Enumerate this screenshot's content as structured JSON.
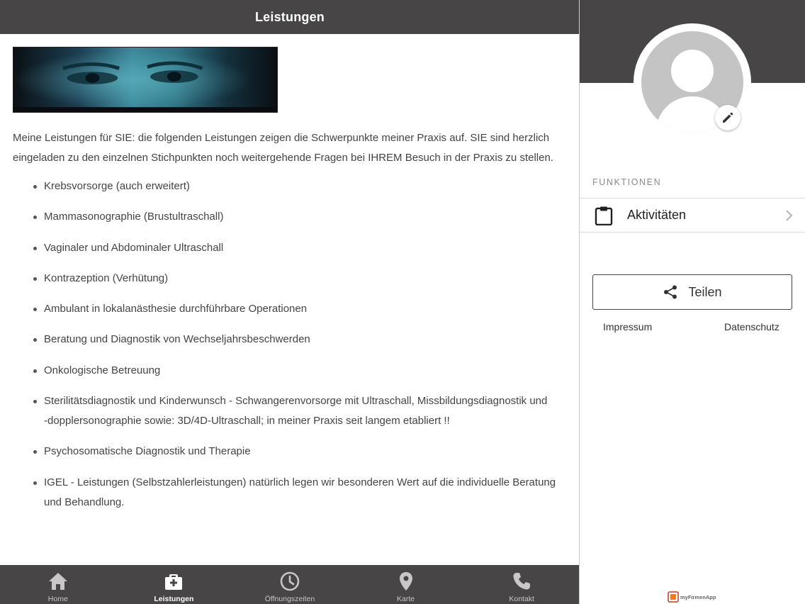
{
  "main": {
    "title": "Leistungen",
    "banner_alt": "",
    "intro": "Meine Leistungen für SIE: die folgenden Leistungen zeigen die Schwerpunkte meiner Praxis auf. SIE sind herzlich eingeladen zu den einzelnen Stichpunkten noch weitergehende Fragen bei IHREM Besuch in der Praxis zu stellen.",
    "services": [
      "Krebsvorsorge (auch erweitert)",
      "Mammasonographie (Brustultraschall)",
      "Vaginaler und Abdominaler Ultraschall",
      "Kontrazeption (Verhütung)",
      "Ambulant in lokalanästhesie durchführbare Operationen",
      "Beratung und Diagnostik von Wechseljahrsbeschwerden",
      "Onkologische Betreuung"
    ],
    "service_sterility": {
      "line1": "Sterilitätsdiagnostik und Kinderwunsch - Schwangerenvorsorge mit Ultraschall, Missbildungsdiagnostik und",
      "line2": "-dopplersonographie sowie: 3D/4D-Ultraschall; in meiner Praxis seit langem etabliert !!"
    },
    "services_after": [
      "Psychosomatische Diagnostik und Therapie",
      "IGEL - Leistungen (Selbstzahlerleistungen) natürlich legen wir besonderen Wert auf die individuelle Beratung und Behandlung."
    ]
  },
  "tabs": [
    {
      "label": "Home",
      "icon": "home-icon",
      "active": false
    },
    {
      "label": "Leistungen",
      "icon": "medical-bag-icon",
      "active": true
    },
    {
      "label": "Öffnungszeiten",
      "icon": "clock-icon",
      "active": false
    },
    {
      "label": "Karte",
      "icon": "map-pin-icon",
      "active": false
    },
    {
      "label": "Kontakt",
      "icon": "phone-icon",
      "active": false
    }
  ],
  "side": {
    "section_label": "FUNKTIONEN",
    "menu_item": "Aktivitäten",
    "share_label": "Teilen",
    "impressum": "Impressum",
    "datenschutz": "Datenschutz",
    "logo_text": "myFirmenApp"
  },
  "colors": {
    "bar": "#474546",
    "text": "#444444",
    "avatar": "#c4c4c4"
  }
}
